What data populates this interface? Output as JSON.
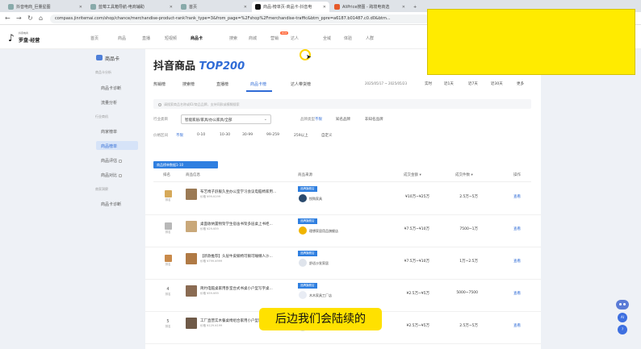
{
  "browser": {
    "tabs": [
      {
        "title": "抖音电商_巨量星图"
      },
      {
        "title": "蓝莓工具箱导航-电商辅助"
      },
      {
        "title": "首页"
      },
      {
        "title": "商品-榜单页-商品卡-抖音电"
      },
      {
        "title": "AliPrice搜图 - 跨境电商选"
      }
    ],
    "url": "compass.jinritemai.com/shop/chance/merchandise-product-rank?rank_type=3&from_page=%2Fshop%2Fmerchandise-traffic&btm_ppre=a6187.b01487.c0.d0&btm..."
  },
  "header": {
    "logo_small": "抖音电商",
    "logo_name": "罗盘·经营",
    "nav": [
      "首页",
      "商品",
      "直播",
      "短视频",
      "商品卡",
      "搜索",
      "商城",
      "营销",
      "达人",
      "全域",
      "体验",
      "人群"
    ],
    "hot_badge": "HOT"
  },
  "sidebar": {
    "title": "商品卡",
    "groups": [
      {
        "label": "商品卡分析",
        "items": [
          "商品卡诊断",
          "流量分析"
        ]
      },
      {
        "label": "行业商机",
        "items": [
          "商家榜单",
          "商品榜单",
          "商品评估",
          "商品对比"
        ]
      },
      {
        "label": "商家洞察",
        "items": [
          "商品卡诊断"
        ]
      }
    ],
    "active": "商品榜单"
  },
  "main": {
    "title_cn": "抖音商品 ",
    "title_en": "TOP200",
    "rank_tabs": [
      "热销榜",
      "搜索榜",
      "直播榜",
      "商品卡榜",
      "达人带货榜"
    ],
    "date_range": "2025/05/17 ~ 2025/05/23",
    "periods": [
      "实时",
      "近1天",
      "近7天",
      "近30天",
      "更多"
    ],
    "search_placeholder": "请搜索商品名称或ID/商品品牌，支持同款或模糊搜索",
    "filters": {
      "industry_label": "行业类目",
      "industry_value": "智能家居/家具/办公家具/全部",
      "brand_label": "品牌类型",
      "brand_options": [
        "不限",
        "知名品牌",
        "非知名品牌"
      ],
      "price_label": "价格区间",
      "price_options": [
        "不限",
        "0-10",
        "10-30",
        "30-99",
        "99-259",
        "259以上",
        "自定义"
      ]
    },
    "export_label": "商品榜单数据1-10",
    "table": {
      "headers": [
        "排名",
        "商品信息",
        "商品来源",
        "成交金额",
        "成交件数",
        "操作"
      ],
      "rows": [
        {
          "rank": "1",
          "rank_sub": "排名",
          "name": "布艺椅子舒服久坐办公室学习会议电脑椅家用...",
          "price": "价格 ¥99-¥199",
          "shop_chip": "品牌旗舰店",
          "shop": "悦购家具",
          "sales": "¥10万~¥25万",
          "gmv": "2.5万~5万",
          "op": "查看"
        },
        {
          "rank": "2",
          "rank_sub": "排名",
          "name": "桌面收纳置物架学生宿舍书架多层桌上书柜...",
          "price": "价格 ¥29-¥59",
          "shop_chip": "品牌旗舰店",
          "shop": "理想家居用品旗舰店",
          "sales": "¥7.5万~¥10万",
          "gmv": "7500~1万",
          "op": "查看"
        },
        {
          "rank": "3",
          "rank_sub": "排名",
          "name": "【新款推荐】头层牛皮躺椅可躺可睡懒人沙...",
          "price": "价格 ¥799-¥999",
          "shop_chip": "品牌旗舰店",
          "shop": "舒适沙发家居",
          "sales": "¥7.5万~¥10万",
          "gmv": "1万~2.5万",
          "op": "查看"
        },
        {
          "rank": "4",
          "rank_sub": "排名",
          "name": "简约电脑桌家用卧室台式书桌小户型写字桌...",
          "price": "价格 ¥59-¥99",
          "shop_chip": "品牌旗舰店",
          "shop": "木木家具工厂店",
          "sales": "¥2.5万~¥5万",
          "gmv": "5000~7500",
          "op": "查看"
        },
        {
          "rank": "5",
          "rank_sub": "排名",
          "name": "工厂直营实木餐桌椅组合家用小户型现代...",
          "price": "价格 ¥129-¥199",
          "shop_chip": "品牌旗舰店",
          "shop": "实木家居馆",
          "sales": "¥2.5万~¥5万",
          "gmv": "2.5万~5万",
          "op": "查看"
        }
      ]
    }
  },
  "subtitle": "后边我们会陆续的",
  "colors": {
    "accent": "#2f6bd6",
    "overlay": "#ffeb00",
    "subtitle_bg": "#ffe100"
  }
}
